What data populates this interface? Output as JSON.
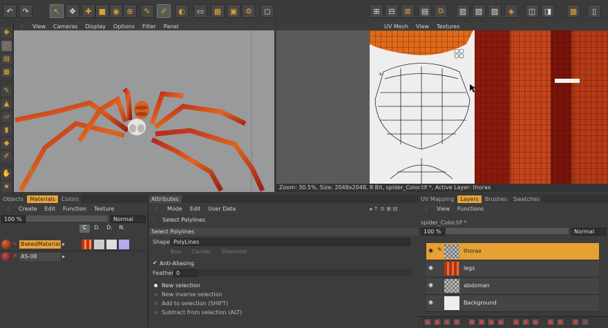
{
  "viewport_menu": [
    "View",
    "Cameras",
    "Display",
    "Options",
    "Filter",
    "Panel"
  ],
  "uv_menu": [
    "UV Mesh",
    "View",
    "Textures"
  ],
  "status_text": "Zoom: 30.5%, Size: 2048x2048, 8 Bit, spider_Color.tif *, Active Layer: thorax",
  "left_tabs": [
    {
      "label": "Objects",
      "active": false
    },
    {
      "label": "Materials",
      "active": true
    },
    {
      "label": "Colors",
      "active": false
    }
  ],
  "materials_menu": [
    "Create",
    "Edit",
    "Function",
    "Texture"
  ],
  "materials_zoom": "100 %",
  "materials_blend": "Normal",
  "materials_rows": [
    {
      "name": "BakedMaterial",
      "active": true
    },
    {
      "name": "AS-08",
      "active": false
    }
  ],
  "material_channels": [
    "C",
    "D.",
    "D.",
    "N."
  ],
  "attr_tab": "Attributes",
  "attr_menu": [
    "Mode",
    "Edit",
    "User Data"
  ],
  "attr_title": "Select Polylines",
  "attr_section": "Select Polylines",
  "shape_label": "Shape",
  "shape_value": "PolyLines",
  "shape_options": [
    "Box",
    "Center",
    "Diameter"
  ],
  "antialias_label": "Anti-Aliasing",
  "feather_label": "Feather",
  "feather_value": "0",
  "selection_modes": [
    "New selection",
    "New inverse selection",
    "Add to selection (SHIFT)",
    "Subtract from selection (ALT)"
  ],
  "right_tabs": [
    {
      "label": "UV Mapping",
      "active": false
    },
    {
      "label": "Layers",
      "active": true
    },
    {
      "label": "Brushes",
      "active": false
    },
    {
      "label": "Swatches",
      "active": false
    }
  ],
  "layers_menu": [
    "View",
    "Functions"
  ],
  "layers_file": "spider_Color.tif *",
  "layers_zoom": "100 %",
  "layers_blend": "Normal",
  "layers": [
    {
      "name": "thorax",
      "active": true
    },
    {
      "name": "legs",
      "active": false
    },
    {
      "name": "abdoman",
      "active": false
    },
    {
      "name": "Background",
      "active": false
    }
  ]
}
